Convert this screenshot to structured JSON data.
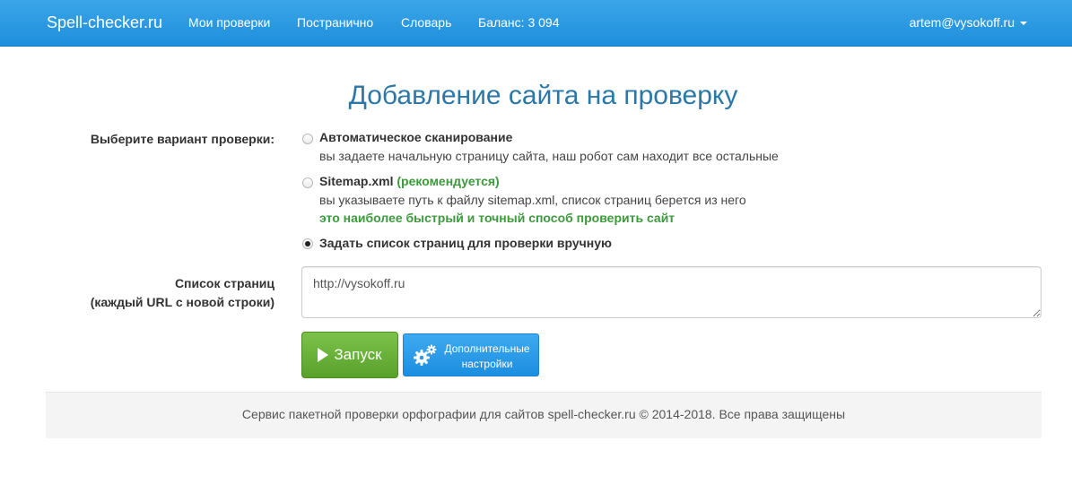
{
  "navbar": {
    "brand": "Spell-checker.ru",
    "links": [
      "Мои проверки",
      "Постранично",
      "Словарь"
    ],
    "balance": "Баланс: 3 094",
    "user": "artem@vysokoff.ru"
  },
  "page": {
    "title": "Добавление сайта на проверку"
  },
  "form": {
    "mode_label": "Выберите вариант проверки:",
    "options": [
      {
        "title": "Автоматическое сканирование",
        "description": "вы задаете начальную страницу сайта, наш робот сам находит все остальные",
        "checked": false
      },
      {
        "title": "Sitemap.xml",
        "badge": "(рекомендуется)",
        "description": "вы указываете путь к файлу sitemap.xml, список страниц берется из него",
        "note": "это наиболее быстрый и точный способ проверить сайт",
        "checked": false
      },
      {
        "title": "Задать список страниц для проверки вручную",
        "checked": true
      }
    ],
    "pages_label_line1": "Список страниц",
    "pages_label_line2": "(каждый URL с новой строки)",
    "pages_value": "http://vysokoff.ru",
    "run_button": "Запуск",
    "settings_button_line1": "Дополнительные",
    "settings_button_line2": "настройки"
  },
  "footer": {
    "text": "Сервис пакетной проверки орфографии для сайтов spell-checker.ru © 2014-2018. Все права защищены"
  },
  "colors": {
    "navbar": "#2196e0",
    "title": "#2b78a8",
    "accent_green": "#3c9a3c",
    "run_button": "#67b137",
    "settings_button": "#2a9be8"
  }
}
